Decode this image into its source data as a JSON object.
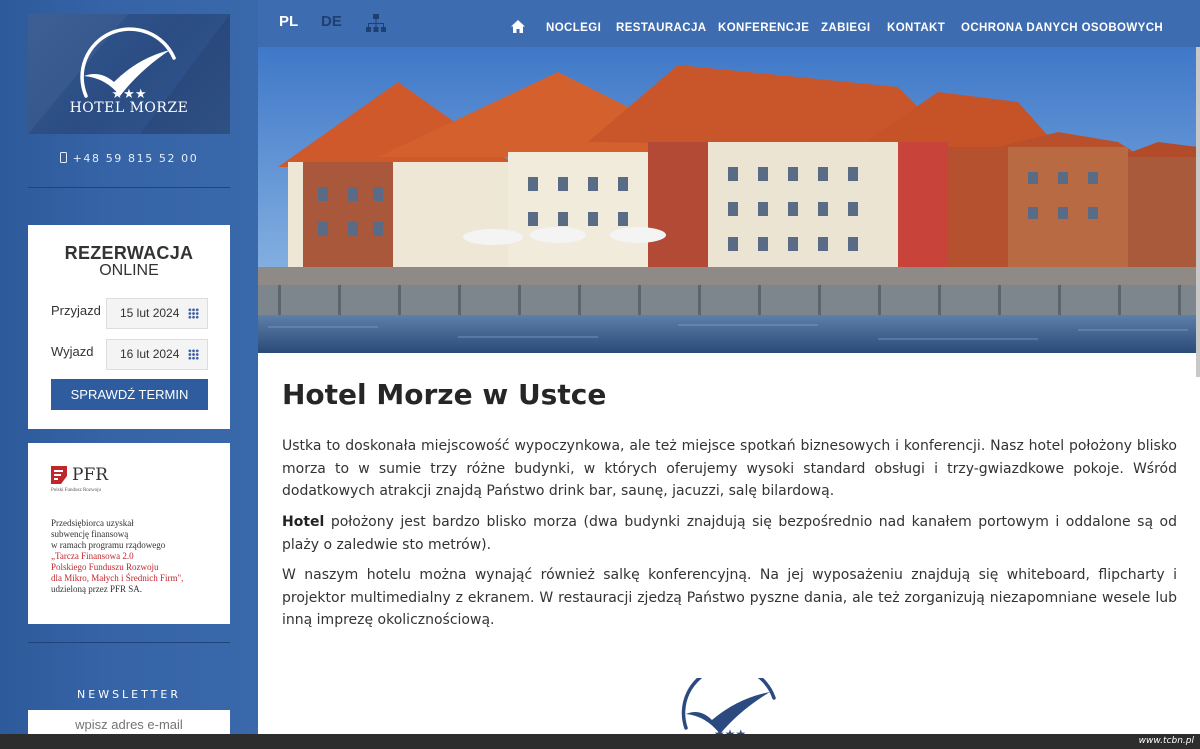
{
  "brand": {
    "name": "HOTEL MORZE",
    "stars": "★★★"
  },
  "contact": {
    "phone": "+48 59 815 52 00"
  },
  "booking": {
    "title": "REZERWACJA",
    "subtitle": "ONLINE",
    "arrival_label": "Przyjazd",
    "arrival_value": "15 lut 2024",
    "departure_label": "Wyjazd",
    "departure_value": "16 lut 2024",
    "submit_label": "SPRAWDŹ TERMIN"
  },
  "pfr": {
    "name": "PFR",
    "full_name": "Polski Fundusz Rozwoju",
    "lines": [
      "Przedsiębiorca uzyskał",
      "subwencję finansową",
      "w ramach programu rządowego",
      "„Tarcza Finansowa 2.0",
      "Polskiego Funduszu Rozwoju",
      "dla Mikro, Małych i Średnich Firm\",",
      "udzieloną przez PFR SA."
    ]
  },
  "newsletter": {
    "label": "NEWSLETTER",
    "placeholder": "wpisz adres e-mail"
  },
  "languages": {
    "pl": "PL",
    "de": "DE"
  },
  "nav": {
    "items": [
      "NOCLEGI",
      "RESTAURACJA",
      "KONFERENCJE",
      "ZABIEGI",
      "KONTAKT",
      "OCHRONA DANYCH OSOBOWYCH"
    ]
  },
  "content": {
    "title": "Hotel Morze w Ustce",
    "p1": "Ustka to doskonała miejscowość wypoczynkowa, ale też miejsce spotkań biznesowych i konferencji. Nasz hotel położony blisko morza to w sumie trzy różne budynki, w których oferujemy wysoki standard obsługi i trzy-gwiazdkowe pokoje. Wśród dodatkowych atrakcji znajdą Państwo drink bar, saunę, jacuzzi, salę bilardową.",
    "p2_bold": "Hotel",
    "p2_rest": " położony jest bardzo blisko morza (dwa budynki znajdują się bezpośrednio nad kanałem portowym i oddalone są od plaży o zaledwie sto metrów).",
    "p3": "W naszym hotelu można wynająć również salkę konferencyjną. Na jej wyposażeniu znajdują się whiteboard, flipcharty i projektor multimedialny z ekranem. W restauracji zjedzą Państwo pyszne dania, ale też zorganizują niezapomniane wesele lub inną imprezę okolicznościową."
  },
  "watermark": "www.tcbn.pl",
  "colors": {
    "sidebar": "#3563a6",
    "topbar": "#3d6cb1",
    "button": "#2e5c9e",
    "pfr_red": "#c0272d"
  }
}
